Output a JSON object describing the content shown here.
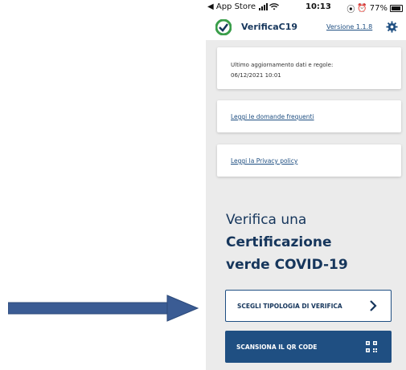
{
  "status_bar": {
    "back_app": "◀ App Store",
    "time": "10:13",
    "battery": "77%"
  },
  "header": {
    "app_name": "VerificaC19",
    "version_link": "Versione 1.1.8",
    "logo_icon": "verificac19-logo-icon",
    "settings_icon": "gear-icon"
  },
  "update_card": {
    "label": "Ultimo aggiornamento dati e regole:",
    "value": "06/12/2021 10:01"
  },
  "faq_link": "Leggi le domande frequenti",
  "privacy_link": "Leggi la Privacy policy",
  "verify": {
    "line1": "Verifica una",
    "line2": "Certificazione",
    "line3": "verde COVID-19"
  },
  "buttons": {
    "choose_label": "SCEGLI TIPOLOGIA DI VERIFICA",
    "scan_label": "SCANSIONA IL QR CODE"
  },
  "colors": {
    "brand_navy": "#16365c",
    "link_blue": "#1f4f82",
    "background": "#ebebeb",
    "annotation_arrow": "#3b5c94"
  }
}
